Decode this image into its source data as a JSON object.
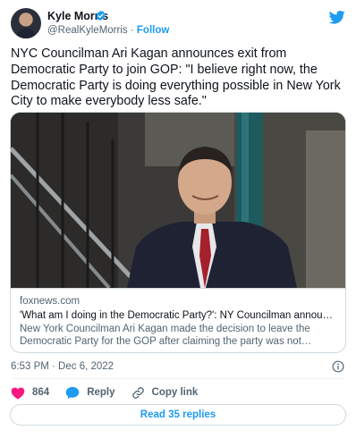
{
  "author": {
    "name": "Kyle Morris",
    "handle": "@RealKyleMorris",
    "separator": "·",
    "follow_label": "Follow",
    "verified": true
  },
  "tweet": {
    "text": "NYC Councilman Ari Kagan announces exit from Democratic Party to join GOP: \"I believe right now, the Democratic Party is doing everything possible in New York City to make everybody less safe.\"",
    "timestamp": "6:53 PM · Dec 6, 2022"
  },
  "link_card": {
    "domain": "foxnews.com",
    "title": "'What am I doing in the Democratic Party?': NY Councilman announces exit from Democratic Party",
    "description": "New York Councilman Ari Kagan made the decision to leave the Democratic Party for the GOP after claiming the party was not properly tackling the crime crisis."
  },
  "actions": {
    "like_count": "864",
    "reply_label": "Reply",
    "copy_link_label": "Copy link"
  },
  "read_replies_label": "Read 35 replies",
  "icons": {
    "brand": "twitter-bird-icon",
    "verified": "verified-badge-icon",
    "info": "info-icon",
    "like": "heart-icon",
    "reply": "speech-bubble-icon",
    "copy_link": "link-icon"
  },
  "colors": {
    "accent": "#1d9bf0",
    "like": "#f91880",
    "text": "#0f1419",
    "secondary": "#536471",
    "border": "#cfd9de"
  }
}
